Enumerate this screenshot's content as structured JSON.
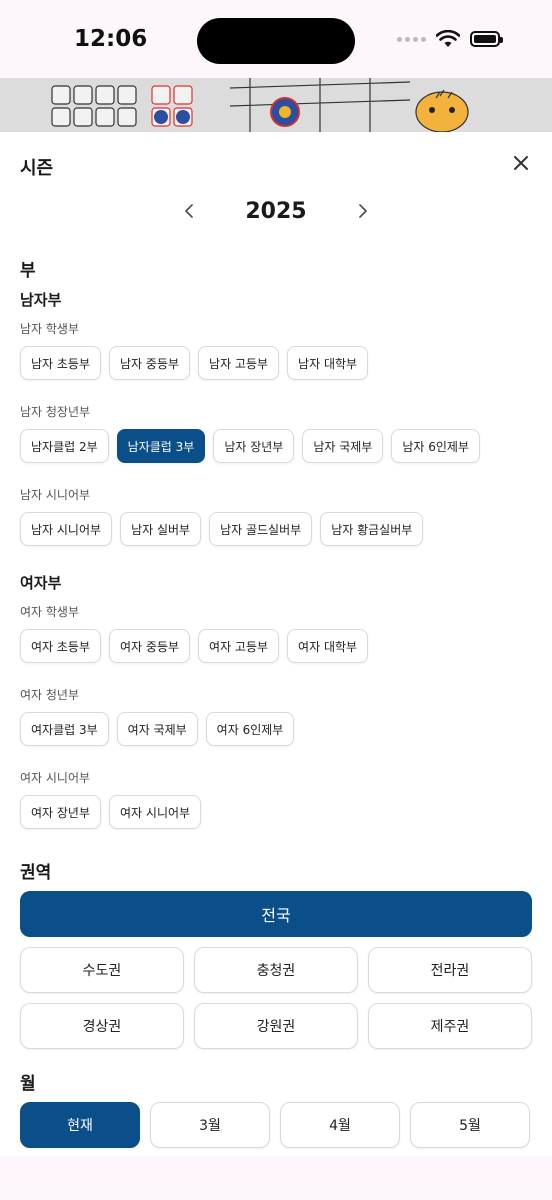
{
  "status": {
    "time": "12:06"
  },
  "sheet": {
    "title": "시즌",
    "year": "2025",
    "division_heading": "부",
    "men": {
      "heading": "남자부",
      "groups": [
        {
          "label": "남자 학생부",
          "items": [
            "남자 초등부",
            "남자 중등부",
            "남자 고등부",
            "남자 대학부"
          ]
        },
        {
          "label": "남자 청장년부",
          "items": [
            "남자클럽 2부",
            "남자클럽 3부",
            "남자 장년부",
            "남자 국제부",
            "남자 6인제부"
          ]
        },
        {
          "label": "남자 시니어부",
          "items": [
            "남자 시니어부",
            "남자 실버부",
            "남자 골드실버부",
            "남자 황금실버부"
          ]
        }
      ]
    },
    "women": {
      "heading": "여자부",
      "groups": [
        {
          "label": "여자 학생부",
          "items": [
            "여자 초등부",
            "여자 중등부",
            "여자 고등부",
            "여자 대학부"
          ]
        },
        {
          "label": "여자 청년부",
          "items": [
            "여자클럽 3부",
            "여자 국제부",
            "여자 6인제부"
          ]
        },
        {
          "label": "여자 시니어부",
          "items": [
            "여자 장년부",
            "여자 시니어부"
          ]
        }
      ]
    },
    "selected_division": "남자클럽 3부",
    "region": {
      "heading": "권역",
      "all": "전국",
      "items": [
        "수도권",
        "충청권",
        "전라권",
        "경상권",
        "강원권",
        "제주권"
      ]
    },
    "month": {
      "heading": "월",
      "items": [
        "현재",
        "3월",
        "4월",
        "5월"
      ],
      "selected": "현재"
    }
  },
  "colors": {
    "accent": "#0b4f8a",
    "chip_border": "#d9d9d9"
  },
  "icons": {
    "close": "close-icon",
    "prev": "chevron-left-icon",
    "next": "chevron-right-icon"
  }
}
